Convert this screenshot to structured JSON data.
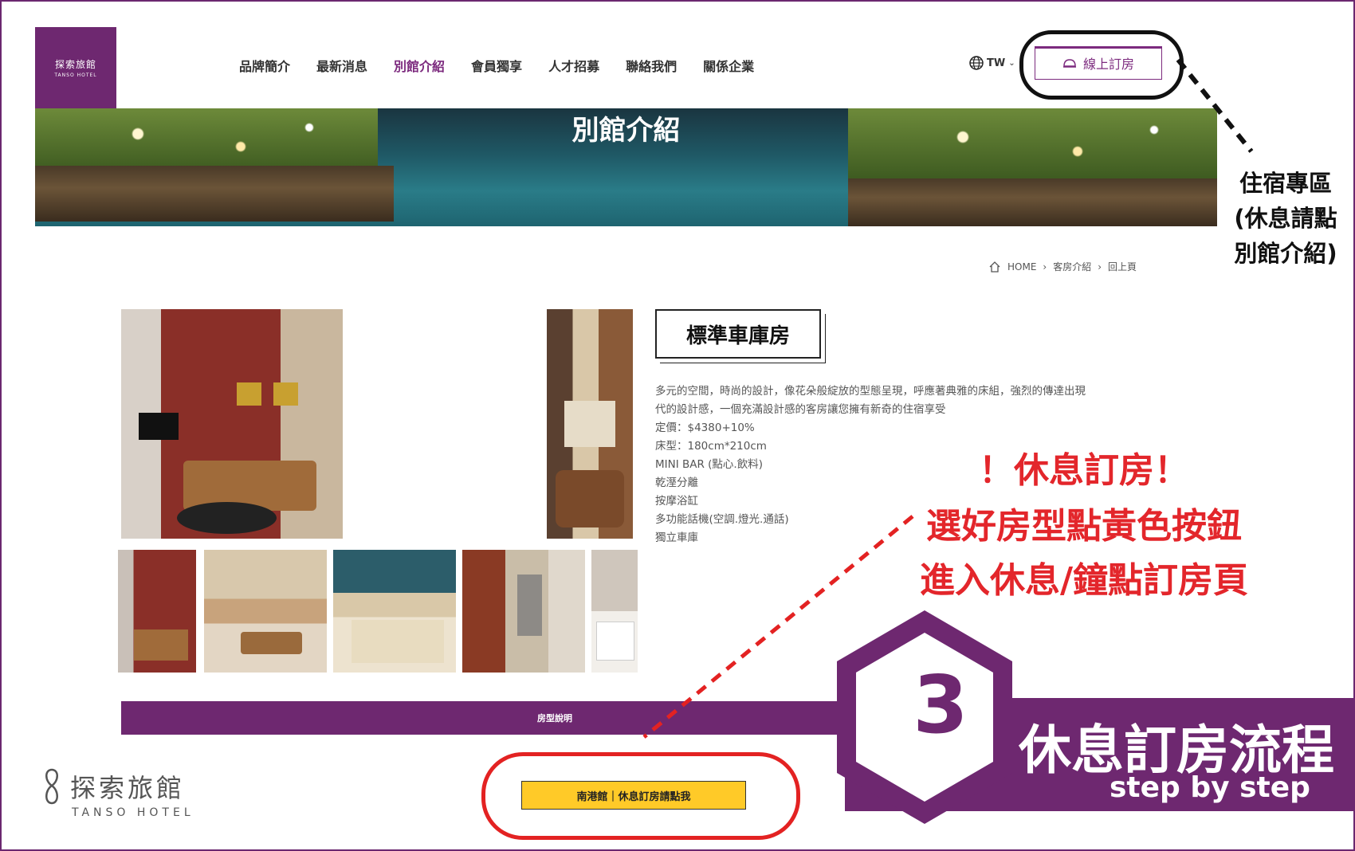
{
  "logo": {
    "cn": "探索旅館",
    "en": "TANSO HOTEL"
  },
  "nav": {
    "items": [
      "品牌簡介",
      "最新消息",
      "別館介紹",
      "會員獨享",
      "人才招募",
      "聯絡我們",
      "關係企業"
    ],
    "active_index": 2
  },
  "lang": {
    "label": "TW",
    "icon": "globe-icon"
  },
  "book_button": {
    "label": "線上訂房",
    "icon": "service-bell-icon"
  },
  "banner": {
    "title": "別館介紹"
  },
  "breadcrumb": [
    "HOME",
    "客房介紹",
    "回上頁"
  ],
  "room": {
    "title": "標準車庫房",
    "description": [
      "多元的空間，時尚的設計，像花朵般綻放的型態呈現，呼應著典雅的床組，強烈的傳達出現",
      "代的設計感，一個充滿設計感的客房讓您擁有新奇的住宿享受",
      "定價：$4380+10%",
      "床型：180cm*210cm",
      "MINI BAR (點心.飲料)",
      "乾溼分離",
      "按摩浴缸",
      "多功能話機(空調.燈光.通話)",
      "獨立車庫"
    ]
  },
  "room_type_bar": {
    "label": "房型說明"
  },
  "yellow_button": {
    "label": "南港館｜休息訂房請點我"
  },
  "annotations": {
    "lodging_note": [
      "住宿專區",
      "(休息請點",
      "別館介紹)"
    ],
    "red_note": [
      "！休息訂房！",
      "選好房型點黃色按鈕",
      "進入休息/鐘點訂房頁"
    ]
  },
  "step": {
    "number": "3",
    "title": "休息訂房流程",
    "subtitle": "step  by step"
  },
  "bottom_logo": {
    "cn": "探索旅館",
    "en": "TANSO HOTEL"
  },
  "colors": {
    "brand_purple": "#6e2870",
    "accent_yellow": "#ffca28",
    "annotation_red": "#e3262b"
  }
}
